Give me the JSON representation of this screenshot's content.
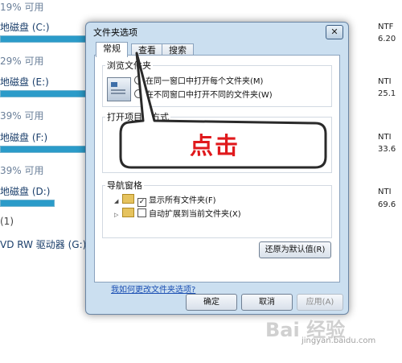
{
  "background": {
    "drives": [
      {
        "pct": "19% 可用",
        "name": "地磁盘 (C:)",
        "fs": "NTF",
        "size": "6.20"
      },
      {
        "pct": "29% 可用",
        "name": "地磁盘 (E:)",
        "fs": "NTI",
        "size": "25.1"
      },
      {
        "pct": "39% 可用",
        "name": "地磁盘 (F:)",
        "fs": "NTI",
        "size": "33.6"
      },
      {
        "pct": "39% 可用",
        "name": "地磁盘 (D:)",
        "fs": "NTI",
        "size": "69.6"
      }
    ],
    "removable_count": "(1)",
    "dvd": "VD RW 驱动器 (G:)"
  },
  "dialog": {
    "title": "文件夹选项",
    "close": "✕",
    "tabs": [
      "常规",
      "查看",
      "搜索"
    ],
    "browse_group": "浏览文件夹",
    "browse_opt1": "在同一窗口中打开每个文件夹(M)",
    "browse_opt2": "在不同窗口中打开不同的文件夹(W)",
    "open_group": "打开项目的方式",
    "nav_group": "导航窗格",
    "nav_opt1": "显示所有文件夹(F)",
    "nav_opt2": "自动扩展到当前文件夹(X)",
    "restore_btn": "还原为默认值(R)",
    "help_link": "我如何更改文件夹选项?",
    "ok": "确定",
    "cancel": "取消",
    "apply": "应用(A)"
  },
  "callout": {
    "text": "点击"
  },
  "watermark": {
    "main": "Bai 经验",
    "sub": "jingyan.baidu.com"
  }
}
